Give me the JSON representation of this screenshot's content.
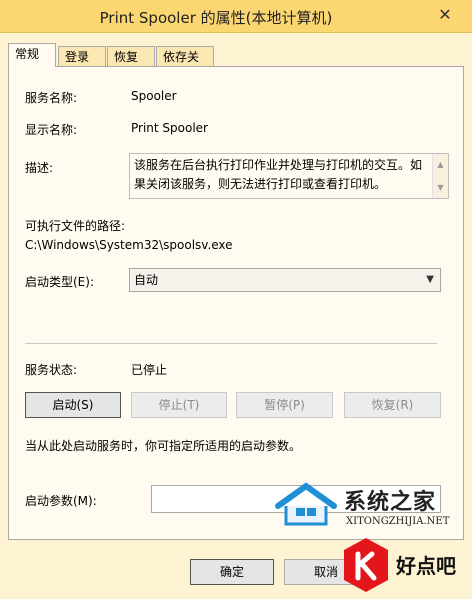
{
  "window": {
    "title": "Print Spooler 的属性(本地计算机)",
    "close_glyph": "✕"
  },
  "tabs": [
    {
      "label": "常规"
    },
    {
      "label": "登录"
    },
    {
      "label": "恢复"
    },
    {
      "label": "依存关系"
    }
  ],
  "general": {
    "service_name_label": "服务名称:",
    "service_name_value": "Spooler",
    "display_name_label": "显示名称:",
    "display_name_value": "Print Spooler",
    "description_label": "描述:",
    "description_text": "该服务在后台执行打印作业并处理与打印机的交互。如果关闭该服务，则无法进行打印或查看打印机。",
    "exe_path_label": "可执行文件的路径:",
    "exe_path_value": "C:\\Windows\\System32\\spoolsv.exe",
    "startup_type_label": "启动类型(E):",
    "startup_type_value": "自动",
    "service_status_label": "服务状态:",
    "service_status_value": "已停止",
    "start_button": "启动(S)",
    "stop_button": "停止(T)",
    "pause_button": "暂停(P)",
    "resume_button": "恢复(R)",
    "hint_text": "当从此处启动服务时，你可指定所适用的启动参数。",
    "start_params_label": "启动参数(M):",
    "start_params_value": ""
  },
  "footer": {
    "ok_button": "确定",
    "cancel_button": "取消"
  },
  "watermarks": {
    "site1_title": "系统之家",
    "site1_url": "XITONGZHIJIA.NET",
    "site2_title": "好点吧"
  },
  "colors": {
    "titlebar": "#fbd671",
    "background": "#fdf3d3",
    "panel": "#fffbf0"
  }
}
